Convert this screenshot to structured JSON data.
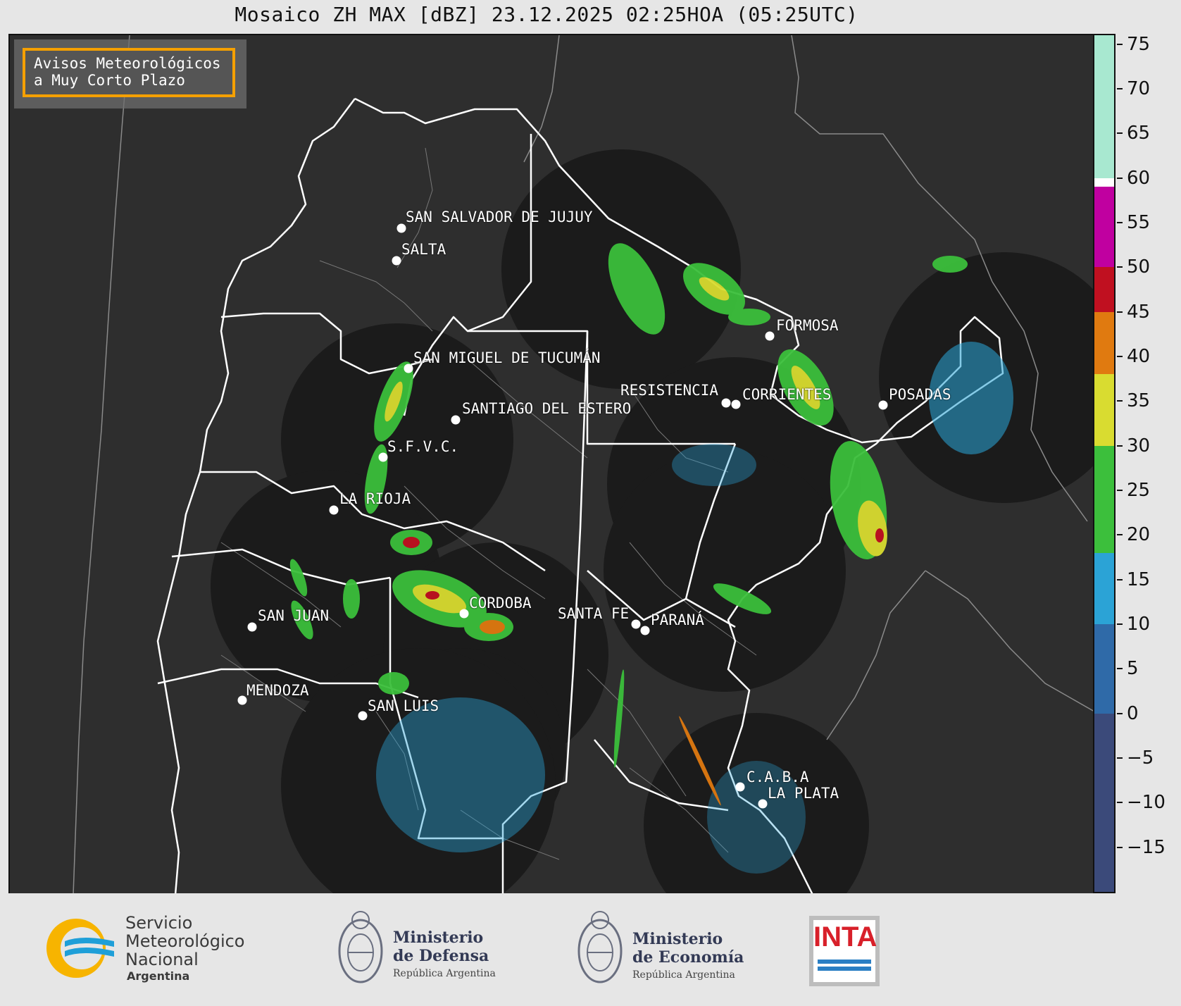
{
  "title": "Mosaico ZH MAX [dBZ] 23.12.2025 02:25HOA (05:25UTC)",
  "warning_box": {
    "line1": "Avisos Meteorológicos",
    "line2": "a Muy Corto Plazo",
    "border_color": "#f5a000"
  },
  "cities": [
    {
      "name": "SAN SALVADOR DE JUJUY"
    },
    {
      "name": "SALTA"
    },
    {
      "name": "SAN MIGUEL DE TUCUMÁN"
    },
    {
      "name": "SANTIAGO DEL ESTERO"
    },
    {
      "name": "S.F.V.C."
    },
    {
      "name": "LA RIOJA"
    },
    {
      "name": "FORMOSA"
    },
    {
      "name": "RESISTENCIA"
    },
    {
      "name": "CORRIENTES"
    },
    {
      "name": "POSADAS"
    },
    {
      "name": "CORDOBA"
    },
    {
      "name": "SANTA FE"
    },
    {
      "name": "PARANÁ"
    },
    {
      "name": "SAN JUAN"
    },
    {
      "name": "MENDOZA"
    },
    {
      "name": "SAN LUIS"
    },
    {
      "name": "C.A.B.A"
    },
    {
      "name": "LA PLATA"
    }
  ],
  "colorbar": {
    "unit": "dBZ",
    "range": [
      -20,
      76
    ],
    "ticks": [
      "75",
      "70",
      "65",
      "60",
      "55",
      "50",
      "45",
      "40",
      "35",
      "30",
      "25",
      "20",
      "15",
      "10",
      "5",
      "0",
      "−5",
      "−10",
      "−15"
    ],
    "colors": [
      {
        "from": -20,
        "to": 0,
        "color": "#3b4a7a"
      },
      {
        "from": 0,
        "to": 10,
        "color": "#2f6aa8"
      },
      {
        "from": 10,
        "to": 18,
        "color": "#2ba3d6"
      },
      {
        "from": 18,
        "to": 30,
        "color": "#3cbf3c"
      },
      {
        "from": 30,
        "to": 38,
        "color": "#d9dc30"
      },
      {
        "from": 38,
        "to": 45,
        "color": "#e07a10"
      },
      {
        "from": 45,
        "to": 50,
        "color": "#c01020"
      },
      {
        "from": 50,
        "to": 59,
        "color": "#c000a0"
      },
      {
        "from": 59,
        "to": 60,
        "color": "#ffffff"
      },
      {
        "from": 60,
        "to": 76,
        "color": "#a8e8d0"
      }
    ]
  },
  "footer": {
    "smn": {
      "line1": "Servicio",
      "line2": "Meteorológico",
      "line3": "Nacional",
      "line4": "Argentina"
    },
    "defensa": {
      "line1": "Ministerio",
      "line2": "de Defensa",
      "line3": "República Argentina"
    },
    "economia": {
      "line1": "Ministerio",
      "line2": "de Economía",
      "line3": "República Argentina"
    },
    "inta": {
      "text": "INTA"
    }
  }
}
